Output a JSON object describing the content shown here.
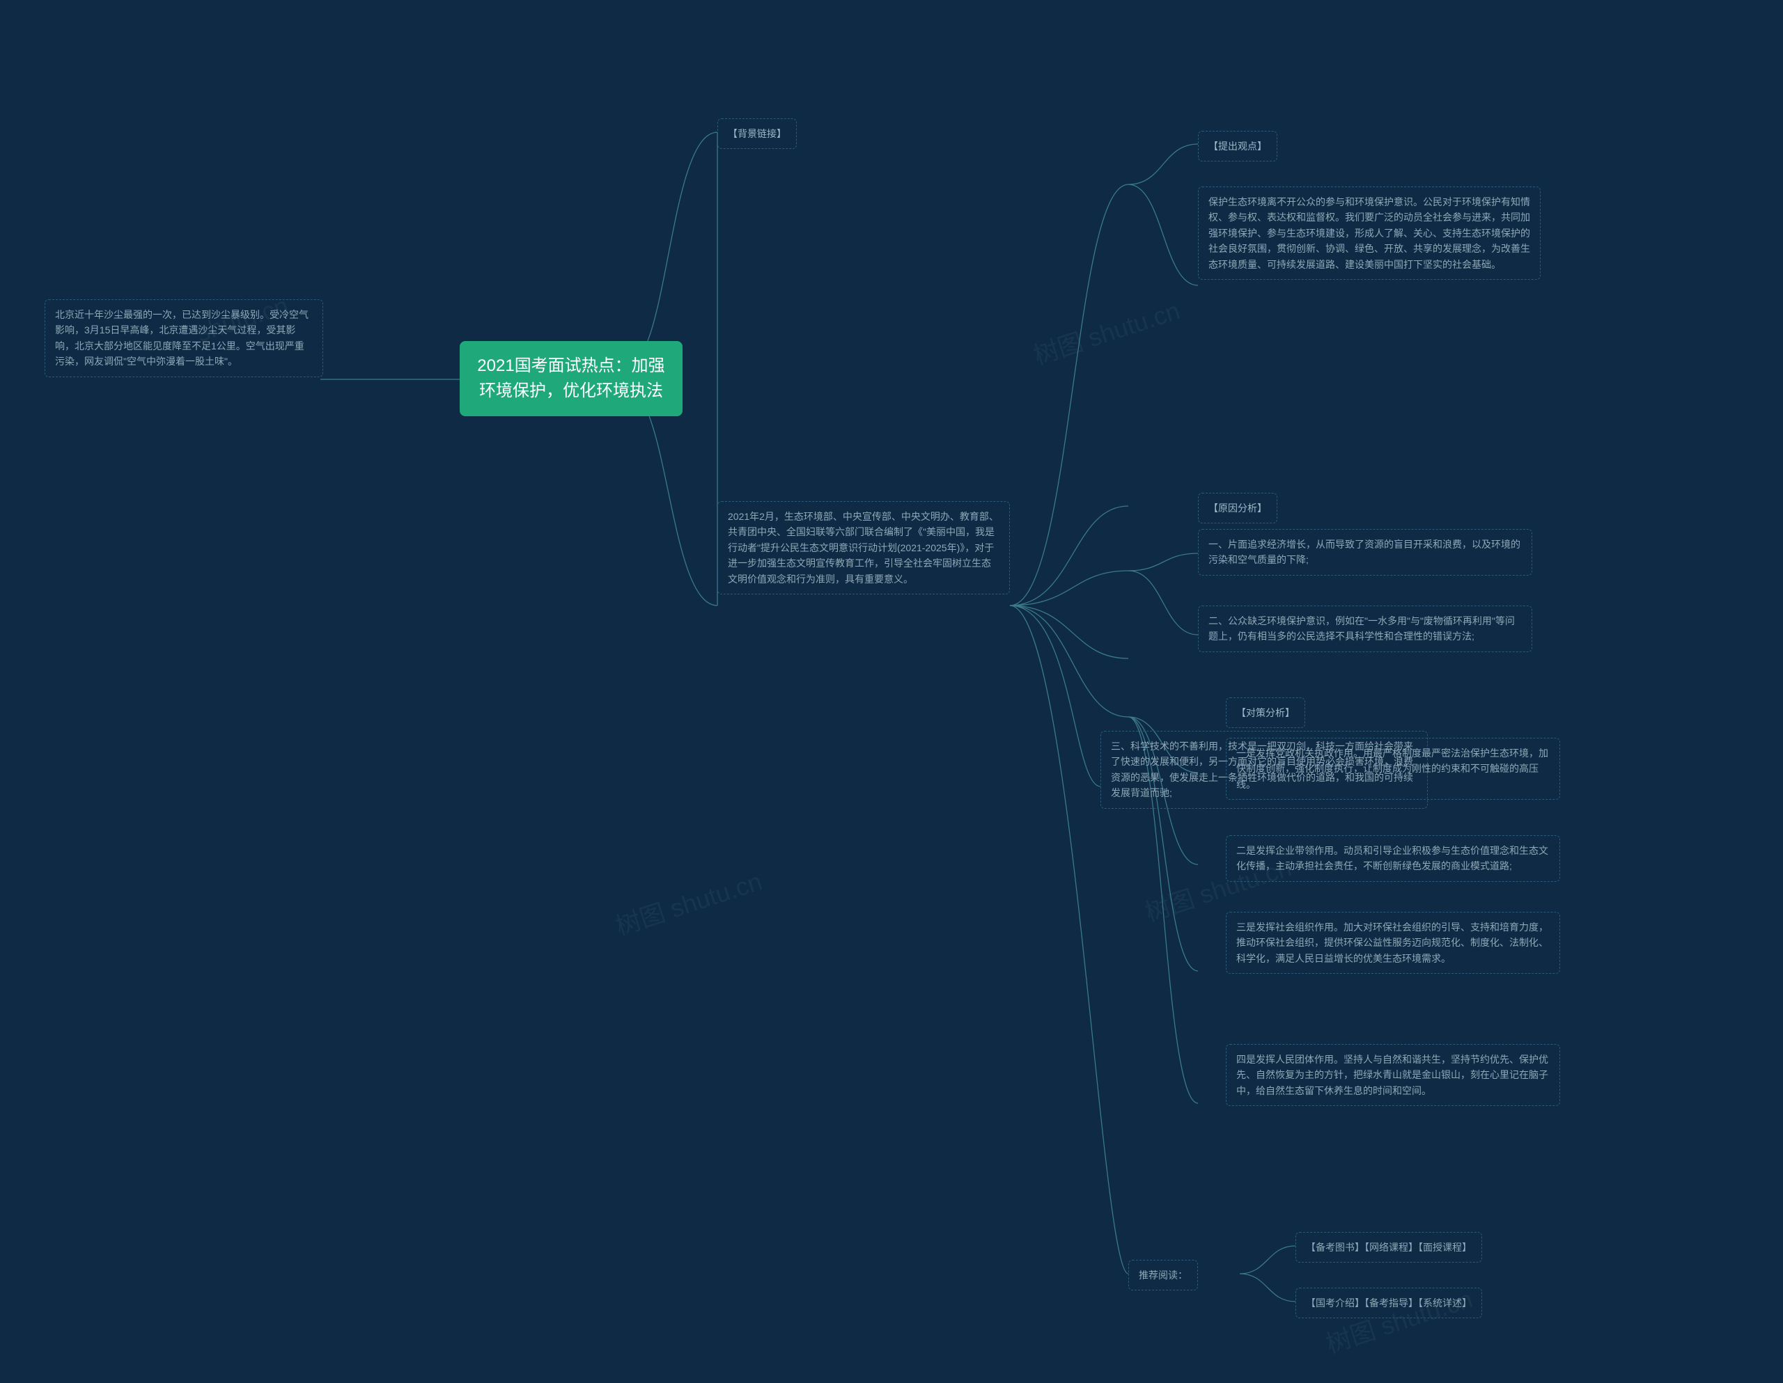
{
  "root": "2021国考面试热点：加强环境保护，优化环境执法",
  "left": {
    "beijing": "北京近十年沙尘最强的一次，已达到沙尘暴级别。受冷空气影响，3月15日早高峰，北京遭遇沙尘天气过程，受其影响，北京大部分地区能见度降至不足1公里。空气出现严重污染，网友调侃\"空气中弥漫着一股土味\"。"
  },
  "col1": {
    "bg_header": "【背景链接】",
    "bg_text": "2021年2月，生态环境部、中央宣传部、中央文明办、教育部、共青团中央、全国妇联等六部门联合编制了《\"美丽中国，我是行动者\"提升公民生态文明意识行动计划(2021-2025年)》，对于进一步加强生态文明宣传教育工作，引导全社会牢固树立生态文明价值观念和行为准则，具有重要意义。"
  },
  "col2": {
    "reason3": "三、科学技术的不善利用，技术是一把双刃剑，科技一方面给社会带来了快速的发展和便利，另一方面对它的盲目使用势必会损害环境，浪费资源的恶果，使发展走上一条牺牲环境做代价的道路，和我国的可持续发展背道而驰;",
    "recommend": "推荐阅读："
  },
  "col3": {
    "viewpoint_header": "【提出观点】",
    "viewpoint_text": "保护生态环境离不开公众的参与和环境保护意识。公民对于环境保护有知情权、参与权、表达权和监督权。我们要广泛的动员全社会参与进来，共同加强环境保护、参与生态环境建设，形成人了解、关心、支持生态环境保护的社会良好氛围，贯彻创新、协调、绿色、开放、共享的发展理念，为改善生态环境质量、可持续发展道路、建设美丽中国打下坚实的社会基础。",
    "reason_header": "【原因分析】",
    "reason1": "一、片面追求经济增长，从而导致了资源的盲目开采和浪费，以及环境的污染和空气质量的下降;",
    "reason2": "二、公众缺乏环境保护意识，例如在\"一水多用\"与\"废物循环再利用\"等问题上，仍有相当多的公民选择不具科学性和合理性的错误方法;",
    "policy_header": "【对策分析】",
    "policy1": "一是发挥党政机关执政作用。用最严格制度最严密法治保护生态环境，加快制度创新，强化制度执行，让制度成为刚性的约束和不可触碰的高压线。",
    "policy2": "二是发挥企业带领作用。动员和引导企业积极参与生态价值理念和生态文化传播，主动承担社会责任，不断创新绿色发展的商业模式道路;",
    "policy3": "三是发挥社会组织作用。加大对环保社会组织的引导、支持和培育力度，推动环保社会组织，提供环保公益性服务迈向规范化、制度化、法制化、科学化，满足人民日益增长的优美生态环境需求。",
    "policy4": "四是发挥人民团体作用。坚持人与自然和谐共生，坚持节约优先、保护优先、自然恢复为主的方针，把绿水青山就是金山银山，刻在心里记在脑子中，给自然生态留下休养生息的时间和空间。",
    "link1": "【备考图书】【网络课程】【面授课程】",
    "link2": "【国考介绍】【备考指导】【系统详述】"
  },
  "watermarks": {
    "w1": "树图 shutu.cn",
    "w2": "shutu.cn",
    "w3": "树图 shutu.cn",
    "w4": "树图 shutu.cn",
    "w5": "树图 shutu.cn"
  }
}
